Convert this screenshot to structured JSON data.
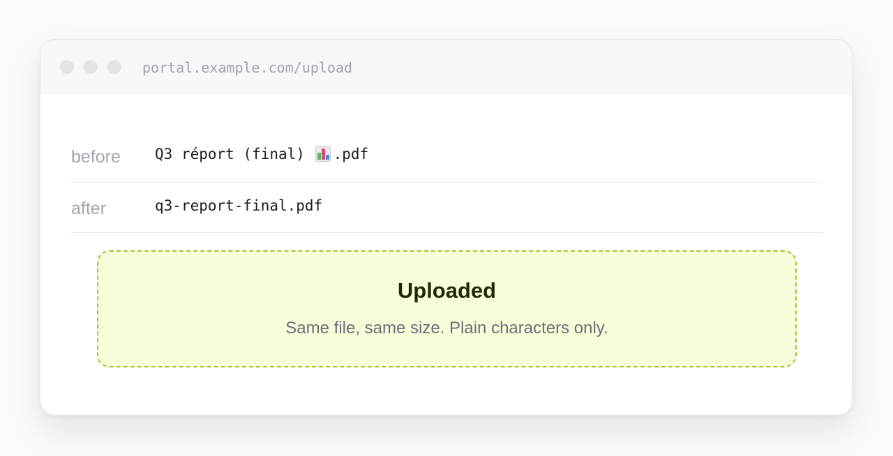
{
  "browser": {
    "url": "portal.example.com/upload"
  },
  "filename_rows": [
    {
      "label": "before",
      "value_prefix": "Q3 répоrt (final) ",
      "value_emoji": "bar-chart-emoji",
      "value_suffix": ".pdf"
    },
    {
      "label": "after",
      "value": "q3-report-final.pdf"
    }
  ],
  "status": {
    "title": "Uploaded",
    "message": "Same file, same size. Plain characters only.",
    "accent_color": "#a3c632",
    "background_color": "#f5fdd9"
  }
}
